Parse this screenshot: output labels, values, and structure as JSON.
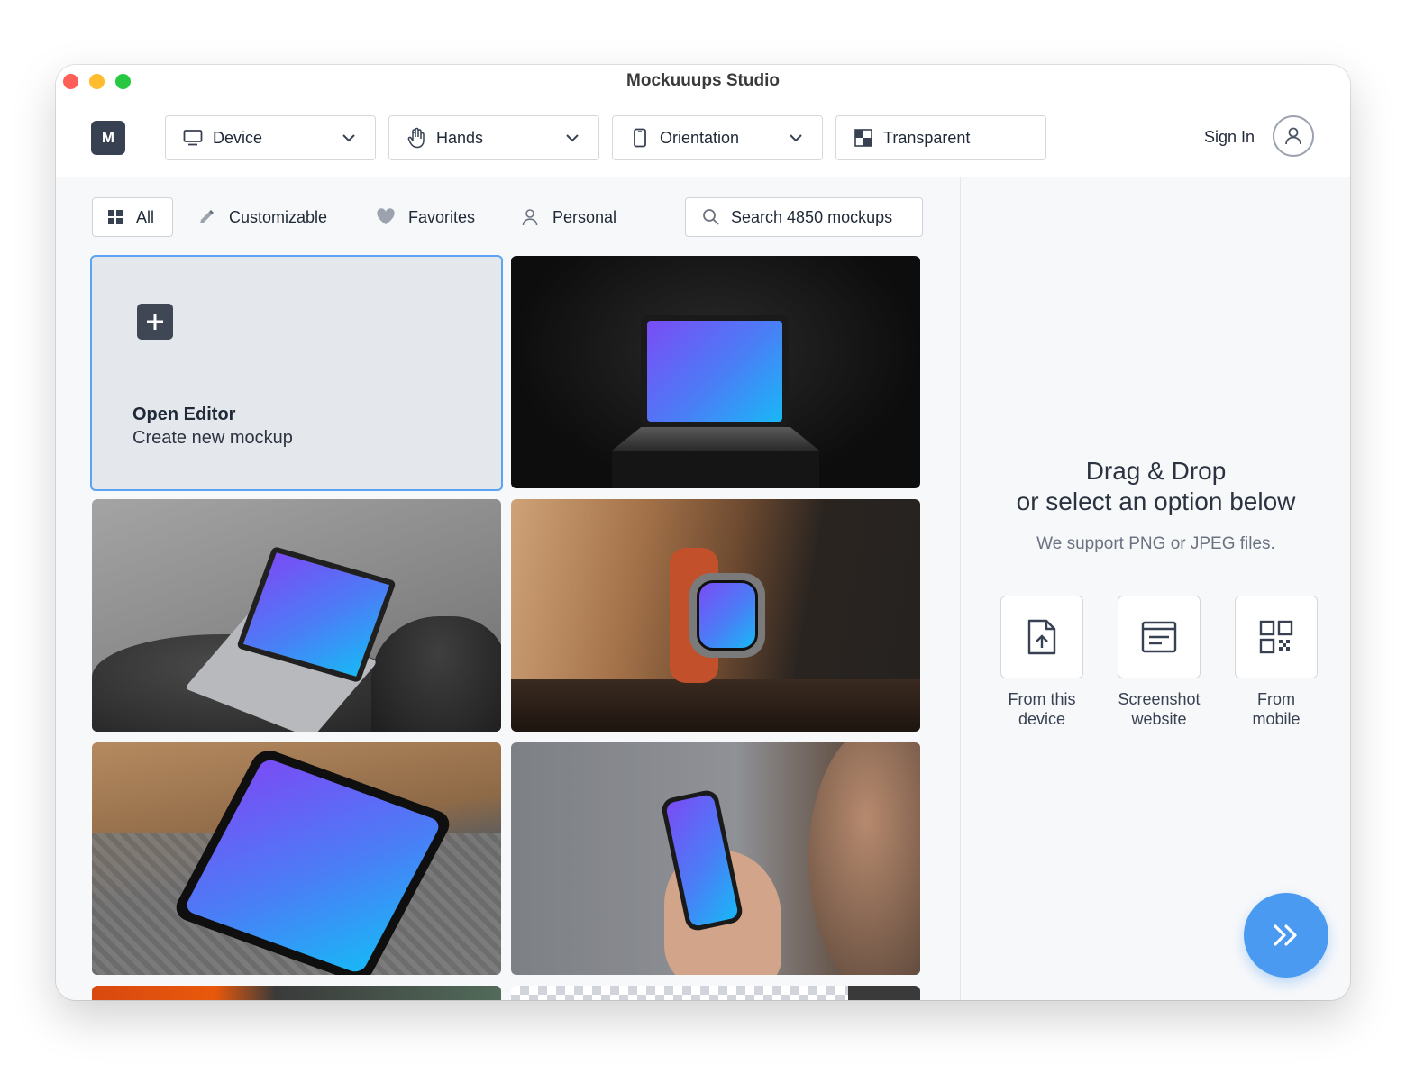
{
  "window": {
    "title": "Mockuuups Studio"
  },
  "toolbar": {
    "logo_letter": "M",
    "dropdowns": [
      {
        "label": "Device",
        "icon": "monitor-icon"
      },
      {
        "label": "Hands",
        "icon": "hand-icon"
      },
      {
        "label": "Orientation",
        "icon": "phone-icon"
      },
      {
        "label": "Transparent",
        "icon": "transparency-icon"
      }
    ],
    "sign_in": "Sign In"
  },
  "filters": [
    {
      "label": "All",
      "icon": "grid-icon",
      "active": true
    },
    {
      "label": "Customizable",
      "icon": "pencil-icon",
      "active": false
    },
    {
      "label": "Favorites",
      "icon": "heart-icon",
      "active": false
    },
    {
      "label": "Personal",
      "icon": "person-icon",
      "active": false
    }
  ],
  "search": {
    "placeholder": "Search 4850 mockups"
  },
  "editor_tile": {
    "title": "Open Editor",
    "subtitle": "Create new mockup"
  },
  "mockups": [
    {
      "device": "laptop"
    },
    {
      "device": "laptop"
    },
    {
      "device": "watch"
    },
    {
      "device": "tablet"
    },
    {
      "device": "phone"
    }
  ],
  "upload_panel": {
    "title_line1": "Drag & Drop",
    "title_line2": "or select an option below",
    "support_text": "We support PNG or JPEG files.",
    "options": [
      {
        "line1": "From this",
        "line2": "device",
        "icon": "file-upload-icon"
      },
      {
        "line1": "Screenshot",
        "line2": "website",
        "icon": "browser-window-icon"
      },
      {
        "line1": "From",
        "line2": "mobile",
        "icon": "qr-code-icon"
      }
    ]
  },
  "colors": {
    "accent": "#4a9af2",
    "selection": "#5ba3f5",
    "logo_bg": "#374151"
  }
}
